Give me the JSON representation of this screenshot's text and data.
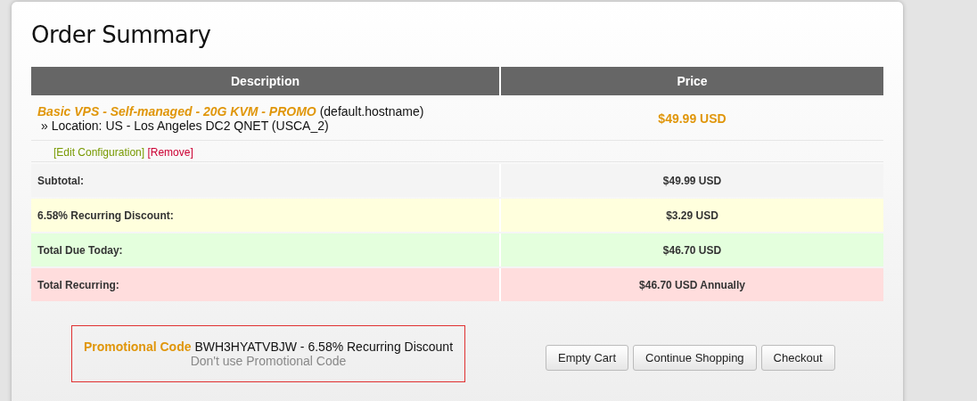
{
  "title": "Order Summary",
  "table": {
    "columns": [
      "Description",
      "Price"
    ],
    "items": [
      {
        "product": "Basic VPS - Self-managed - 20G KVM - PROMO",
        "hostname": "(default.hostname)",
        "detail": "» Location: US - Los Angeles DC2 QNET (USCA_2)",
        "price": "$49.99 USD",
        "edit_link": "[Edit Configuration]",
        "remove_link": "[Remove]"
      }
    ],
    "totals": [
      {
        "kind": "subtotal",
        "label": "Subtotal:",
        "value": "$49.99 USD"
      },
      {
        "kind": "discount",
        "label": "6.58% Recurring Discount:",
        "value": "$3.29 USD"
      },
      {
        "kind": "due",
        "label": "Total Due Today:",
        "value": "$46.70 USD"
      },
      {
        "kind": "recurring",
        "label": "Total Recurring:",
        "value": "$46.70 USD Annually"
      }
    ]
  },
  "promo": {
    "label": "Promotional Code",
    "code": "BWH3HYATVBJW - 6.58% Recurring Discount",
    "remove_link": "Don't use Promotional Code"
  },
  "buttons": [
    "Empty Cart",
    "Continue Shopping",
    "Checkout"
  ]
}
